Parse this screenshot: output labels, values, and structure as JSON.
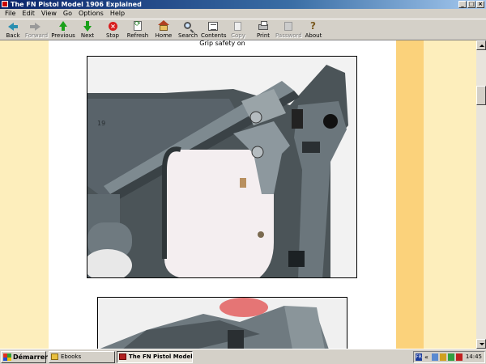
{
  "window": {
    "title": "The FN Pistol Model 1906 Explained",
    "buttons": {
      "minimize": "_",
      "maximize": "□",
      "close": "×"
    }
  },
  "menu": [
    "File",
    "Edit",
    "View",
    "Go",
    "Options",
    "Help"
  ],
  "toolbar": {
    "back": "Back",
    "forward": "Forward",
    "previous": "Previous",
    "next": "Next",
    "stop": "Stop",
    "refresh": "Refresh",
    "home": "Home",
    "search": "Search",
    "contents": "Contents",
    "copy": "Copy",
    "print": "Print",
    "password": "Password",
    "about": "About"
  },
  "page": {
    "caption": "Grip safety on",
    "photo1_stamp": "19"
  },
  "taskbar": {
    "start": "Démarrer",
    "tasks": [
      "Ebooks",
      "The FN Pistol Model 19..."
    ],
    "tray": {
      "lang": "FR",
      "chevron": "«",
      "clock": "14:45"
    }
  },
  "colors": {
    "page_bg": "#fdeebc",
    "accent_column": "#fbd27b",
    "titlebar": "#0a246a"
  }
}
